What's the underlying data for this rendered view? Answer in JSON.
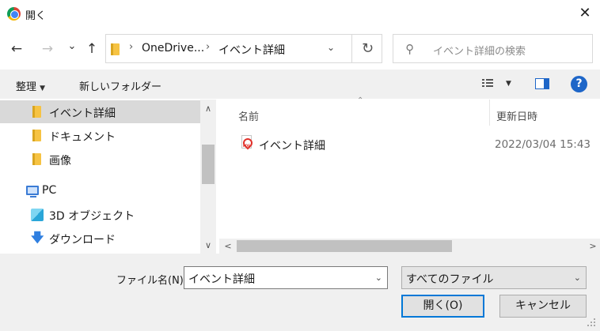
{
  "window": {
    "title": "開く",
    "close_glyph": "✕"
  },
  "nav": {
    "back_glyph": "←",
    "forward_glyph": "→",
    "history_glyph": "⌄",
    "up_glyph": "↑"
  },
  "address": {
    "segments": [
      "OneDrive...",
      "イベント詳細"
    ],
    "separator": "›",
    "refresh_glyph": "↻",
    "dropdown_glyph": "⌄"
  },
  "search": {
    "placeholder": "イベント詳細の検索",
    "icon_glyph": "⚲"
  },
  "toolbar": {
    "organize_label": "整理",
    "new_folder_label": "新しいフォルダー",
    "caret": "▼"
  },
  "sidebar": {
    "items": [
      {
        "label": "イベント詳細",
        "icon": "folder-icon",
        "selected": true
      },
      {
        "label": "ドキュメント",
        "icon": "folder-icon"
      },
      {
        "label": "画像",
        "icon": "folder-icon"
      },
      {
        "label": "PC",
        "icon": "pc-icon"
      },
      {
        "label": "3D オブジェクト",
        "icon": "cube-icon"
      },
      {
        "label": "ダウンロード",
        "icon": "download-icon"
      }
    ],
    "scroll_up": "∧",
    "scroll_down": "∨"
  },
  "filelist": {
    "columns": {
      "name": "名前",
      "modified": "更新日時"
    },
    "sort_glyph": "⌃",
    "files": [
      {
        "name": "イベント詳細",
        "modified": "2022/03/04 15:43",
        "icon": "pdf-icon"
      }
    ],
    "scroll_left": "<",
    "scroll_right": ">"
  },
  "bottom": {
    "filename_label": "ファイル名(N):",
    "filename_value": "イベント詳細",
    "filetype_value": "すべてのファイル",
    "dropdown_glyph": "⌄",
    "open_label": "開く(O)",
    "cancel_label": "キャンセル"
  },
  "colors": {
    "accent": "#0078d7",
    "selection": "#d9d9d9",
    "chrome": "#f0f0f0"
  }
}
